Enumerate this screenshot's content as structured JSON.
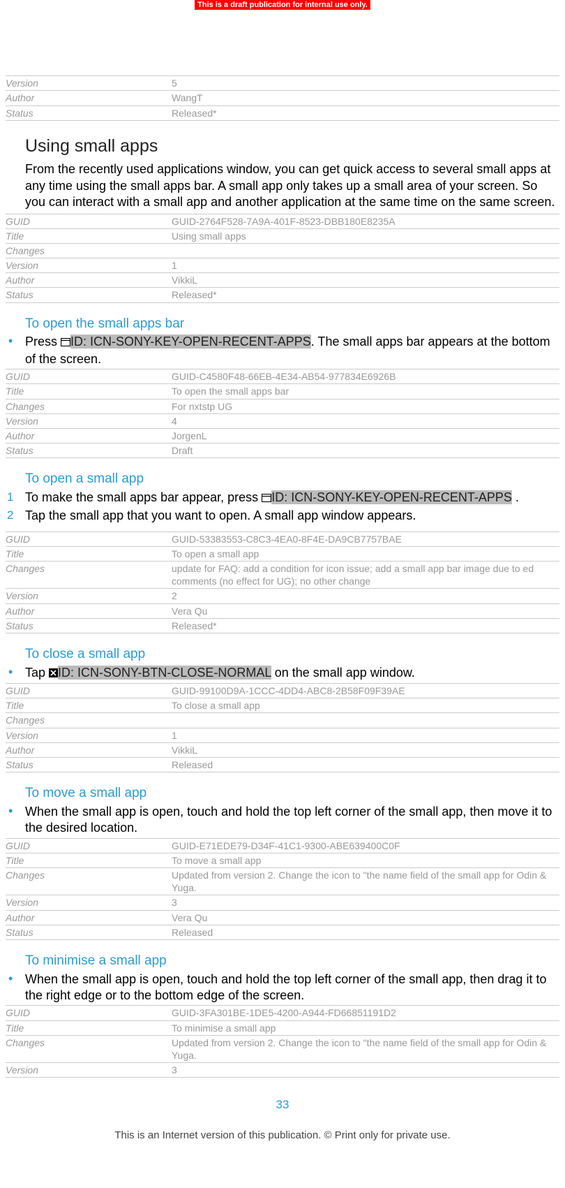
{
  "banner": "This is a draft publication for internal use only.",
  "meta_top": {
    "version_label": "Version",
    "version_value": "5",
    "author_label": "Author",
    "author_value": "WangT",
    "status_label": "Status",
    "status_value": "Released*"
  },
  "section1": {
    "title": "Using small apps",
    "body": "From the recently used applications window, you can get quick access to several small apps at any time using the small apps bar. A small app only takes up a small area of your screen. So you can interact with a small app and another application at the same time on the same screen.",
    "meta": {
      "guid_label": "GUID",
      "guid_value": "GUID-2764F528-7A9A-401F-8523-DBB180E8235A",
      "title_label": "Title",
      "title_value": "Using small apps",
      "changes_label": "Changes",
      "changes_value": "",
      "version_label": "Version",
      "version_value": "1",
      "author_label": "Author",
      "author_value": "VikkiL",
      "status_label": "Status",
      "status_value": "Released*"
    }
  },
  "section2": {
    "title": "To open the small apps bar",
    "bullet_pre": "Press ",
    "bullet_id": "ID: ICN-SONY-KEY-OPEN-RECENT-APPS",
    "bullet_post": ". The small apps bar appears at the bottom of the screen.",
    "meta": {
      "guid_label": "GUID",
      "guid_value": "GUID-C4580F48-66EB-4E34-AB54-977834E6926B",
      "title_label": "Title",
      "title_value": "To open the small apps bar",
      "changes_label": "Changes",
      "changes_value": "For nxtstp UG",
      "version_label": "Version",
      "version_value": "4",
      "author_label": "Author",
      "author_value": "JorgenL",
      "status_label": "Status",
      "status_value": "Draft"
    }
  },
  "section3": {
    "title": "To open a small app",
    "step1_num": "1",
    "step1_pre": "To make the small apps bar appear, press ",
    "step1_id": "ID: ICN-SONY-KEY-OPEN-RECENT-APPS",
    "step1_post": " .",
    "step2_num": "2",
    "step2": "Tap the small app that you want to open. A small app window appears.",
    "meta": {
      "guid_label": "GUID",
      "guid_value": "GUID-53383553-C8C3-4EA0-8F4E-DA9CB7757BAE",
      "title_label": "Title",
      "title_value": "To open a small app",
      "changes_label": "Changes",
      "changes_value": "update for FAQ: add a condition for icon issue; add a small app bar image due to ed comments (no effect for UG); no other change",
      "version_label": "Version",
      "version_value": "2",
      "author_label": "Author",
      "author_value": "Vera Qu",
      "status_label": "Status",
      "status_value": "Released*"
    }
  },
  "section4": {
    "title": "To close a small app",
    "bullet_pre": "Tap ",
    "bullet_id": "ID: ICN-SONY-BTN-CLOSE-NORMAL",
    "bullet_post": " on the small app window.",
    "meta": {
      "guid_label": "GUID",
      "guid_value": "GUID-99100D9A-1CCC-4DD4-ABC8-2B58F09F39AE",
      "title_label": "Title",
      "title_value": "To close a small app",
      "changes_label": "Changes",
      "changes_value": "",
      "version_label": "Version",
      "version_value": "1",
      "author_label": "Author",
      "author_value": "VikkiL",
      "status_label": "Status",
      "status_value": "Released"
    }
  },
  "section5": {
    "title": "To move a small app",
    "bullet": "When the small app is open, touch and hold the top left corner of the small app, then move it to the desired location.",
    "meta": {
      "guid_label": "GUID",
      "guid_value": "GUID-E71EDE79-D34F-41C1-9300-ABE639400C0F",
      "title_label": "Title",
      "title_value": "To move a small app",
      "changes_label": "Changes",
      "changes_value": "Updated from version 2. Change the icon to \"the name field of the small app for Odin & Yuga.",
      "version_label": "Version",
      "version_value": "3",
      "author_label": "Author",
      "author_value": "Vera Qu",
      "status_label": "Status",
      "status_value": "Released"
    }
  },
  "section6": {
    "title": "To minimise a small app",
    "bullet": "When the small app is open, touch and hold the top left corner of the small app, then drag it to the right edge or to the bottom edge of the screen.",
    "meta": {
      "guid_label": "GUID",
      "guid_value": "GUID-3FA301BE-1DE5-4200-A944-FD66851191D2",
      "title_label": "Title",
      "title_value": "To minimise a small app",
      "changes_label": "Changes",
      "changes_value": "Updated from version 2. Change the icon to \"the name field of the small app for Odin & Yuga.",
      "version_label": "Version",
      "version_value": "3"
    }
  },
  "page_number": "33",
  "footer": "This is an Internet version of this publication. © Print only for private use."
}
